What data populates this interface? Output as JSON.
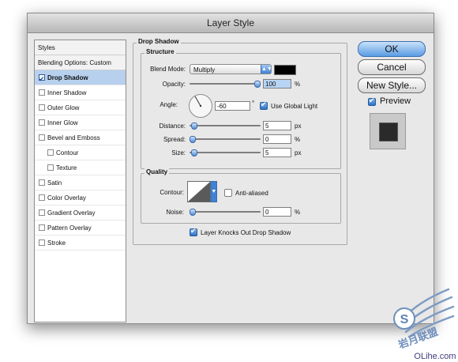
{
  "dialog": {
    "title": "Layer Style"
  },
  "styles_list": {
    "items": [
      {
        "label": "Styles",
        "checked": null,
        "selected": false,
        "indent": 0
      },
      {
        "label": "Blending Options: Custom",
        "checked": null,
        "selected": false,
        "indent": 0
      },
      {
        "label": "Drop Shadow",
        "checked": true,
        "selected": true,
        "indent": 1
      },
      {
        "label": "Inner Shadow",
        "checked": false,
        "selected": false,
        "indent": 1
      },
      {
        "label": "Outer Glow",
        "checked": false,
        "selected": false,
        "indent": 1
      },
      {
        "label": "Inner Glow",
        "checked": false,
        "selected": false,
        "indent": 1
      },
      {
        "label": "Bevel and Emboss",
        "checked": false,
        "selected": false,
        "indent": 1
      },
      {
        "label": "Contour",
        "checked": false,
        "selected": false,
        "indent": 2
      },
      {
        "label": "Texture",
        "checked": false,
        "selected": false,
        "indent": 2
      },
      {
        "label": "Satin",
        "checked": false,
        "selected": false,
        "indent": 1
      },
      {
        "label": "Color Overlay",
        "checked": false,
        "selected": false,
        "indent": 1
      },
      {
        "label": "Gradient Overlay",
        "checked": false,
        "selected": false,
        "indent": 1
      },
      {
        "label": "Pattern Overlay",
        "checked": false,
        "selected": false,
        "indent": 1
      },
      {
        "label": "Stroke",
        "checked": false,
        "selected": false,
        "indent": 1
      }
    ]
  },
  "buttons": {
    "ok": "OK",
    "cancel": "Cancel",
    "new_style": "New Style...",
    "preview_label": "Preview",
    "preview_checked": true
  },
  "drop_shadow": {
    "section_title": "Drop Shadow",
    "structure": {
      "title": "Structure",
      "blend_mode_label": "Blend Mode:",
      "blend_mode_value": "Multiply",
      "shadow_color": "#000000",
      "opacity_label": "Opacity:",
      "opacity_value": "100",
      "opacity_unit": "%",
      "opacity_level": 1.0,
      "angle_label": "Angle:",
      "angle_value": "-60",
      "angle_unit": "°",
      "use_global_light_label": "Use Global Light",
      "use_global_light_checked": true,
      "distance_label": "Distance:",
      "distance_value": "5",
      "distance_unit": "px",
      "distance_level": 0.02,
      "spread_label": "Spread:",
      "spread_value": "0",
      "spread_unit": "%",
      "spread_level": 0.0,
      "size_label": "Size:",
      "size_value": "5",
      "size_unit": "px",
      "size_level": 0.02
    },
    "quality": {
      "title": "Quality",
      "contour_label": "Contour:",
      "anti_aliased_label": "Anti-aliased",
      "anti_aliased_checked": false,
      "noise_label": "Noise:",
      "noise_value": "0",
      "noise_unit": "%",
      "noise_level": 0.0
    },
    "layer_knocks_out_label": "Layer Knocks Out Drop Shadow",
    "layer_knocks_out_checked": true
  },
  "watermark": {
    "site": "OLihe.com",
    "logo_text": "岩月联盟"
  }
}
